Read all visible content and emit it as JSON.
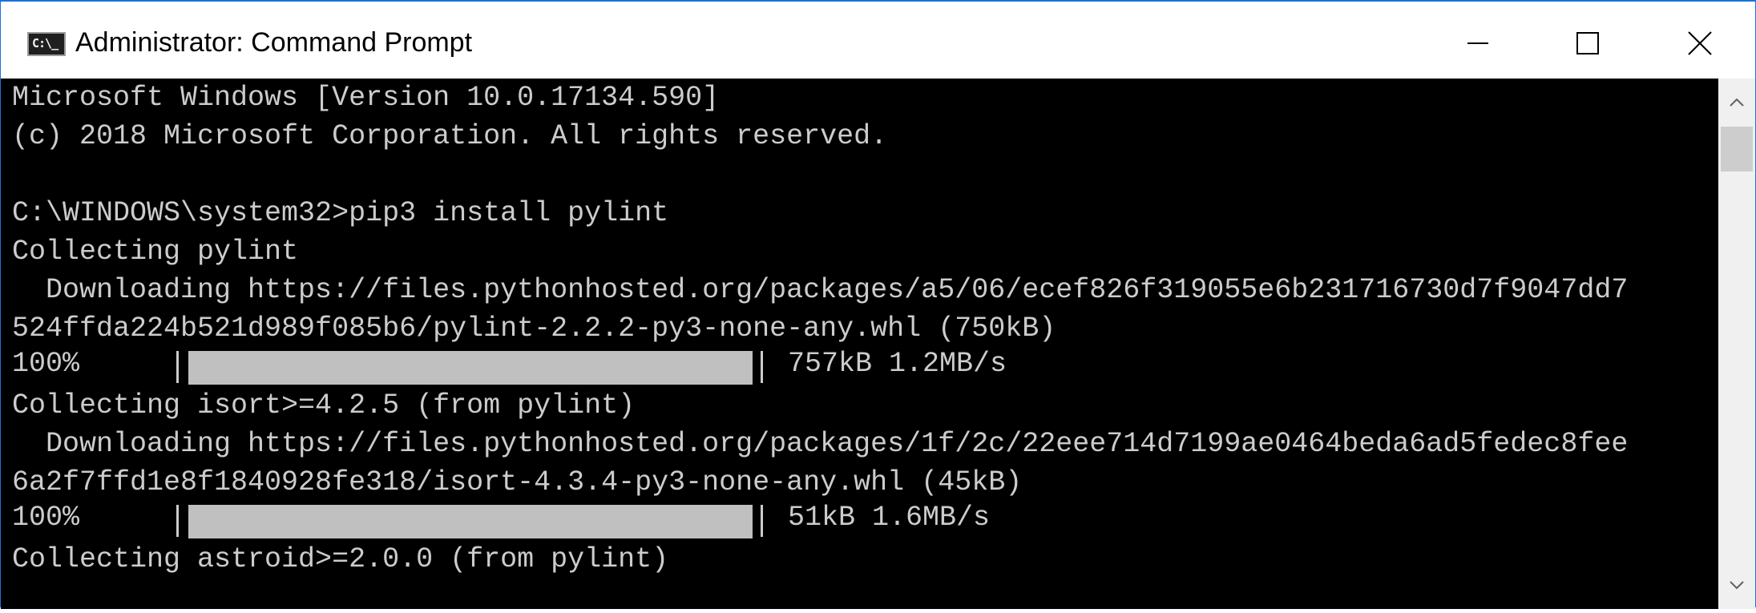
{
  "window": {
    "title": "Administrator: Command Prompt",
    "icon": "cmd-icon",
    "icon_text": "C:\\_",
    "border_color": "#1a73d9"
  },
  "controls": {
    "minimize": "minimize-icon",
    "maximize": "maximize-icon",
    "close": "close-icon"
  },
  "console": {
    "background": "#000000",
    "foreground": "#cccccc",
    "lines": [
      "Microsoft Windows [Version 10.0.17134.590]",
      "(c) 2018 Microsoft Corporation. All rights reserved.",
      "",
      "C:\\WINDOWS\\system32>pip3 install pylint",
      "Collecting pylint",
      "  Downloading https://files.pythonhosted.org/packages/a5/06/ecef826f319055e6b231716730d7f9047dd7",
      "524ffda224b521d989f085b6/pylint-2.2.2-py3-none-any.whl (750kB)",
      "Collecting isort>=4.2.5 (from pylint)",
      "  Downloading https://files.pythonhosted.org/packages/1f/2c/22eee714d7199ae0464beda6ad5fedec8fee",
      "6a2f7ffd1e8f1840928fe318/isort-4.3.4-py3-none-any.whl (45kB)",
      "Collecting astroid>=2.0.0 (from pylint)"
    ],
    "progress": [
      {
        "percent": "100%",
        "fraction": 1.0,
        "rate": "757kB 1.2MB/s"
      },
      {
        "percent": "100%",
        "fraction": 1.0,
        "rate": "51kB 1.6MB/s"
      }
    ]
  },
  "scrollbar": {
    "up": "chevron-up-icon",
    "down": "chevron-down-icon"
  }
}
